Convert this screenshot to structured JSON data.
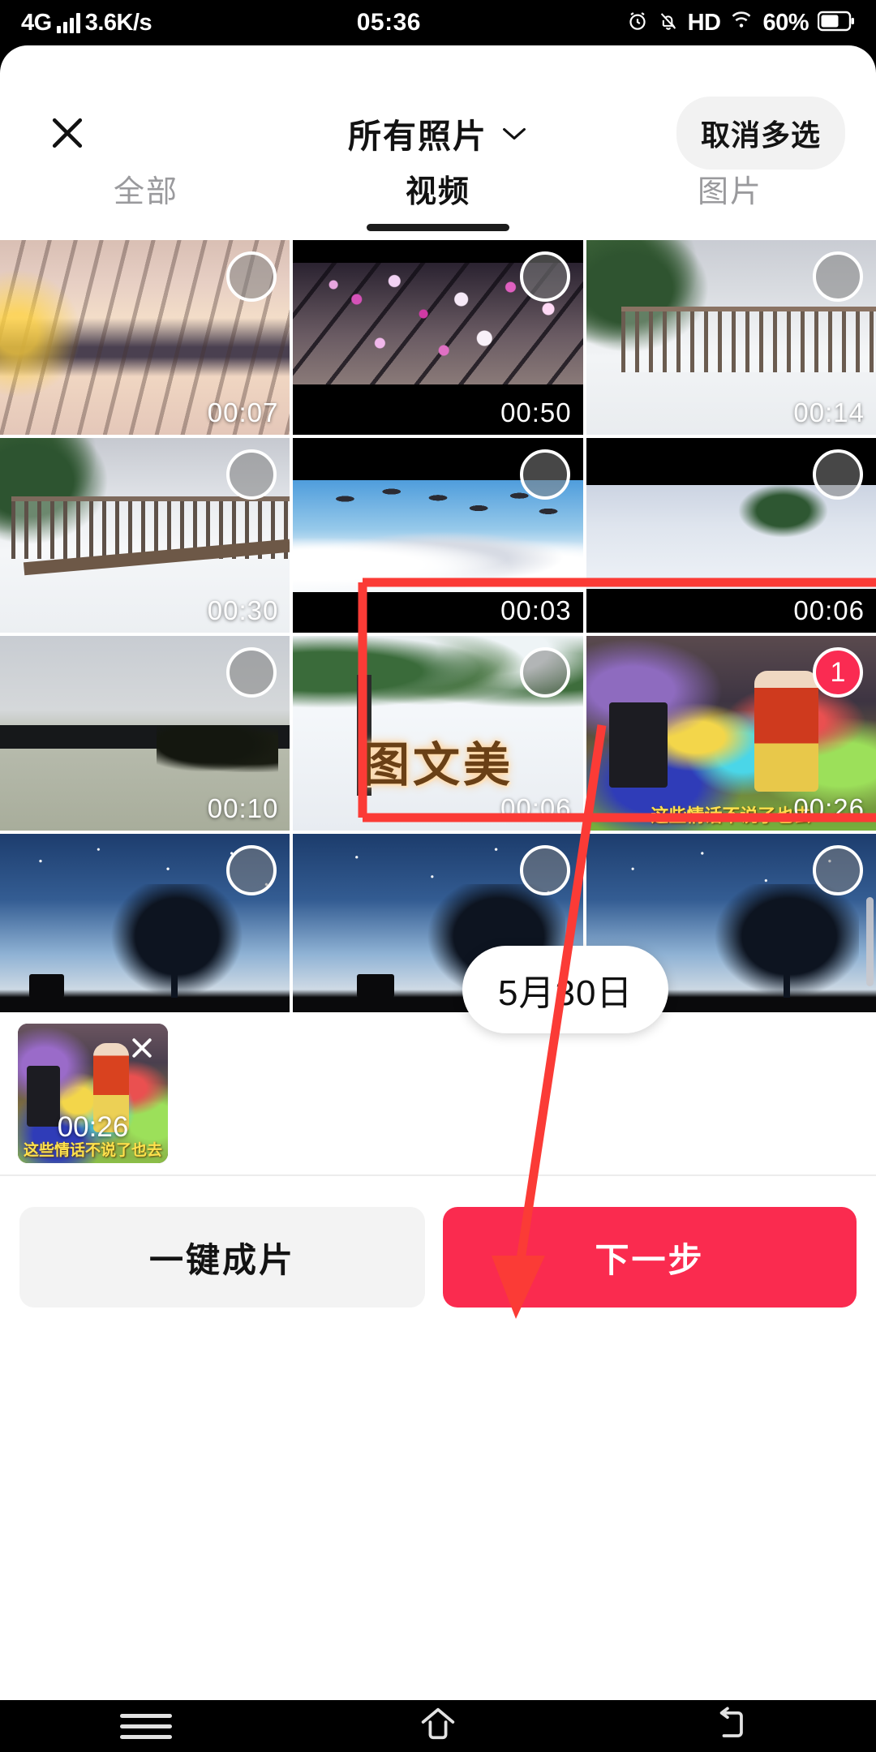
{
  "status_bar": {
    "network_type": "4G",
    "signal_icon": "signal-bars-icon",
    "net_speed": "3.6K/s",
    "time": "05:36",
    "alarm_icon": "alarm-clock-icon",
    "mute_icon": "bell-mute-icon",
    "hd_label": "HD",
    "wifi_icon": "wifi-icon",
    "battery_percent": "60%",
    "battery_icon": "battery-icon"
  },
  "header": {
    "close_icon": "close-icon",
    "title": "所有照片",
    "chevron_icon": "chevron-down-icon",
    "cancel_multi_label": "取消多选"
  },
  "tabs": [
    {
      "label": "全部",
      "active": false
    },
    {
      "label": "视频",
      "active": true
    },
    {
      "label": "图片",
      "active": false
    }
  ],
  "grid": {
    "date_pill": "5月30日",
    "items": [
      {
        "duration": "00:07",
        "selected": false,
        "badge": "",
        "overlay_text": "",
        "overlay_small": ""
      },
      {
        "duration": "00:50",
        "selected": false,
        "badge": "",
        "overlay_text": "",
        "overlay_small": ""
      },
      {
        "duration": "00:14",
        "selected": false,
        "badge": "",
        "overlay_text": "",
        "overlay_small": ""
      },
      {
        "duration": "00:30",
        "selected": false,
        "badge": "",
        "overlay_text": "",
        "overlay_small": ""
      },
      {
        "duration": "00:03",
        "selected": false,
        "badge": "",
        "overlay_text": "",
        "overlay_small": ""
      },
      {
        "duration": "00:06",
        "selected": false,
        "badge": "",
        "overlay_text": "",
        "overlay_small": ""
      },
      {
        "duration": "00:10",
        "selected": false,
        "badge": "",
        "overlay_text": "",
        "overlay_small": ""
      },
      {
        "duration": "00:06",
        "selected": false,
        "badge": "",
        "overlay_text": "图文美",
        "overlay_small": ""
      },
      {
        "duration": "00:26",
        "selected": true,
        "badge": "1",
        "overlay_text": "",
        "overlay_small": "这些情话不说了也去"
      },
      {
        "duration": "",
        "selected": false,
        "badge": "",
        "overlay_text": "",
        "overlay_small": ""
      },
      {
        "duration": "",
        "selected": false,
        "badge": "",
        "overlay_text": "",
        "overlay_small": ""
      },
      {
        "duration": "",
        "selected": false,
        "badge": "",
        "overlay_text": "",
        "overlay_small": ""
      }
    ]
  },
  "tray": {
    "remove_icon": "close-icon",
    "duration": "00:26",
    "caption": "这些情话不说了也去"
  },
  "action_bar": {
    "one_click_label": "一键成片",
    "next_label": "下一步"
  },
  "nav_bar": {
    "recents_icon": "hamburger-menu-icon",
    "home_icon": "home-icon",
    "back_icon": "back-arrow-icon"
  },
  "annotation": {
    "color": "#fb3b36",
    "highlight_box_label": "selection-highlight-rectangle",
    "arrow_label": "guide-arrow-to-next-button"
  },
  "colors": {
    "accent_red": "#fa2b4f",
    "badge_red": "#fa2b52",
    "chip_gray": "#f2f2f2",
    "annotation_red": "#fb3b36"
  }
}
